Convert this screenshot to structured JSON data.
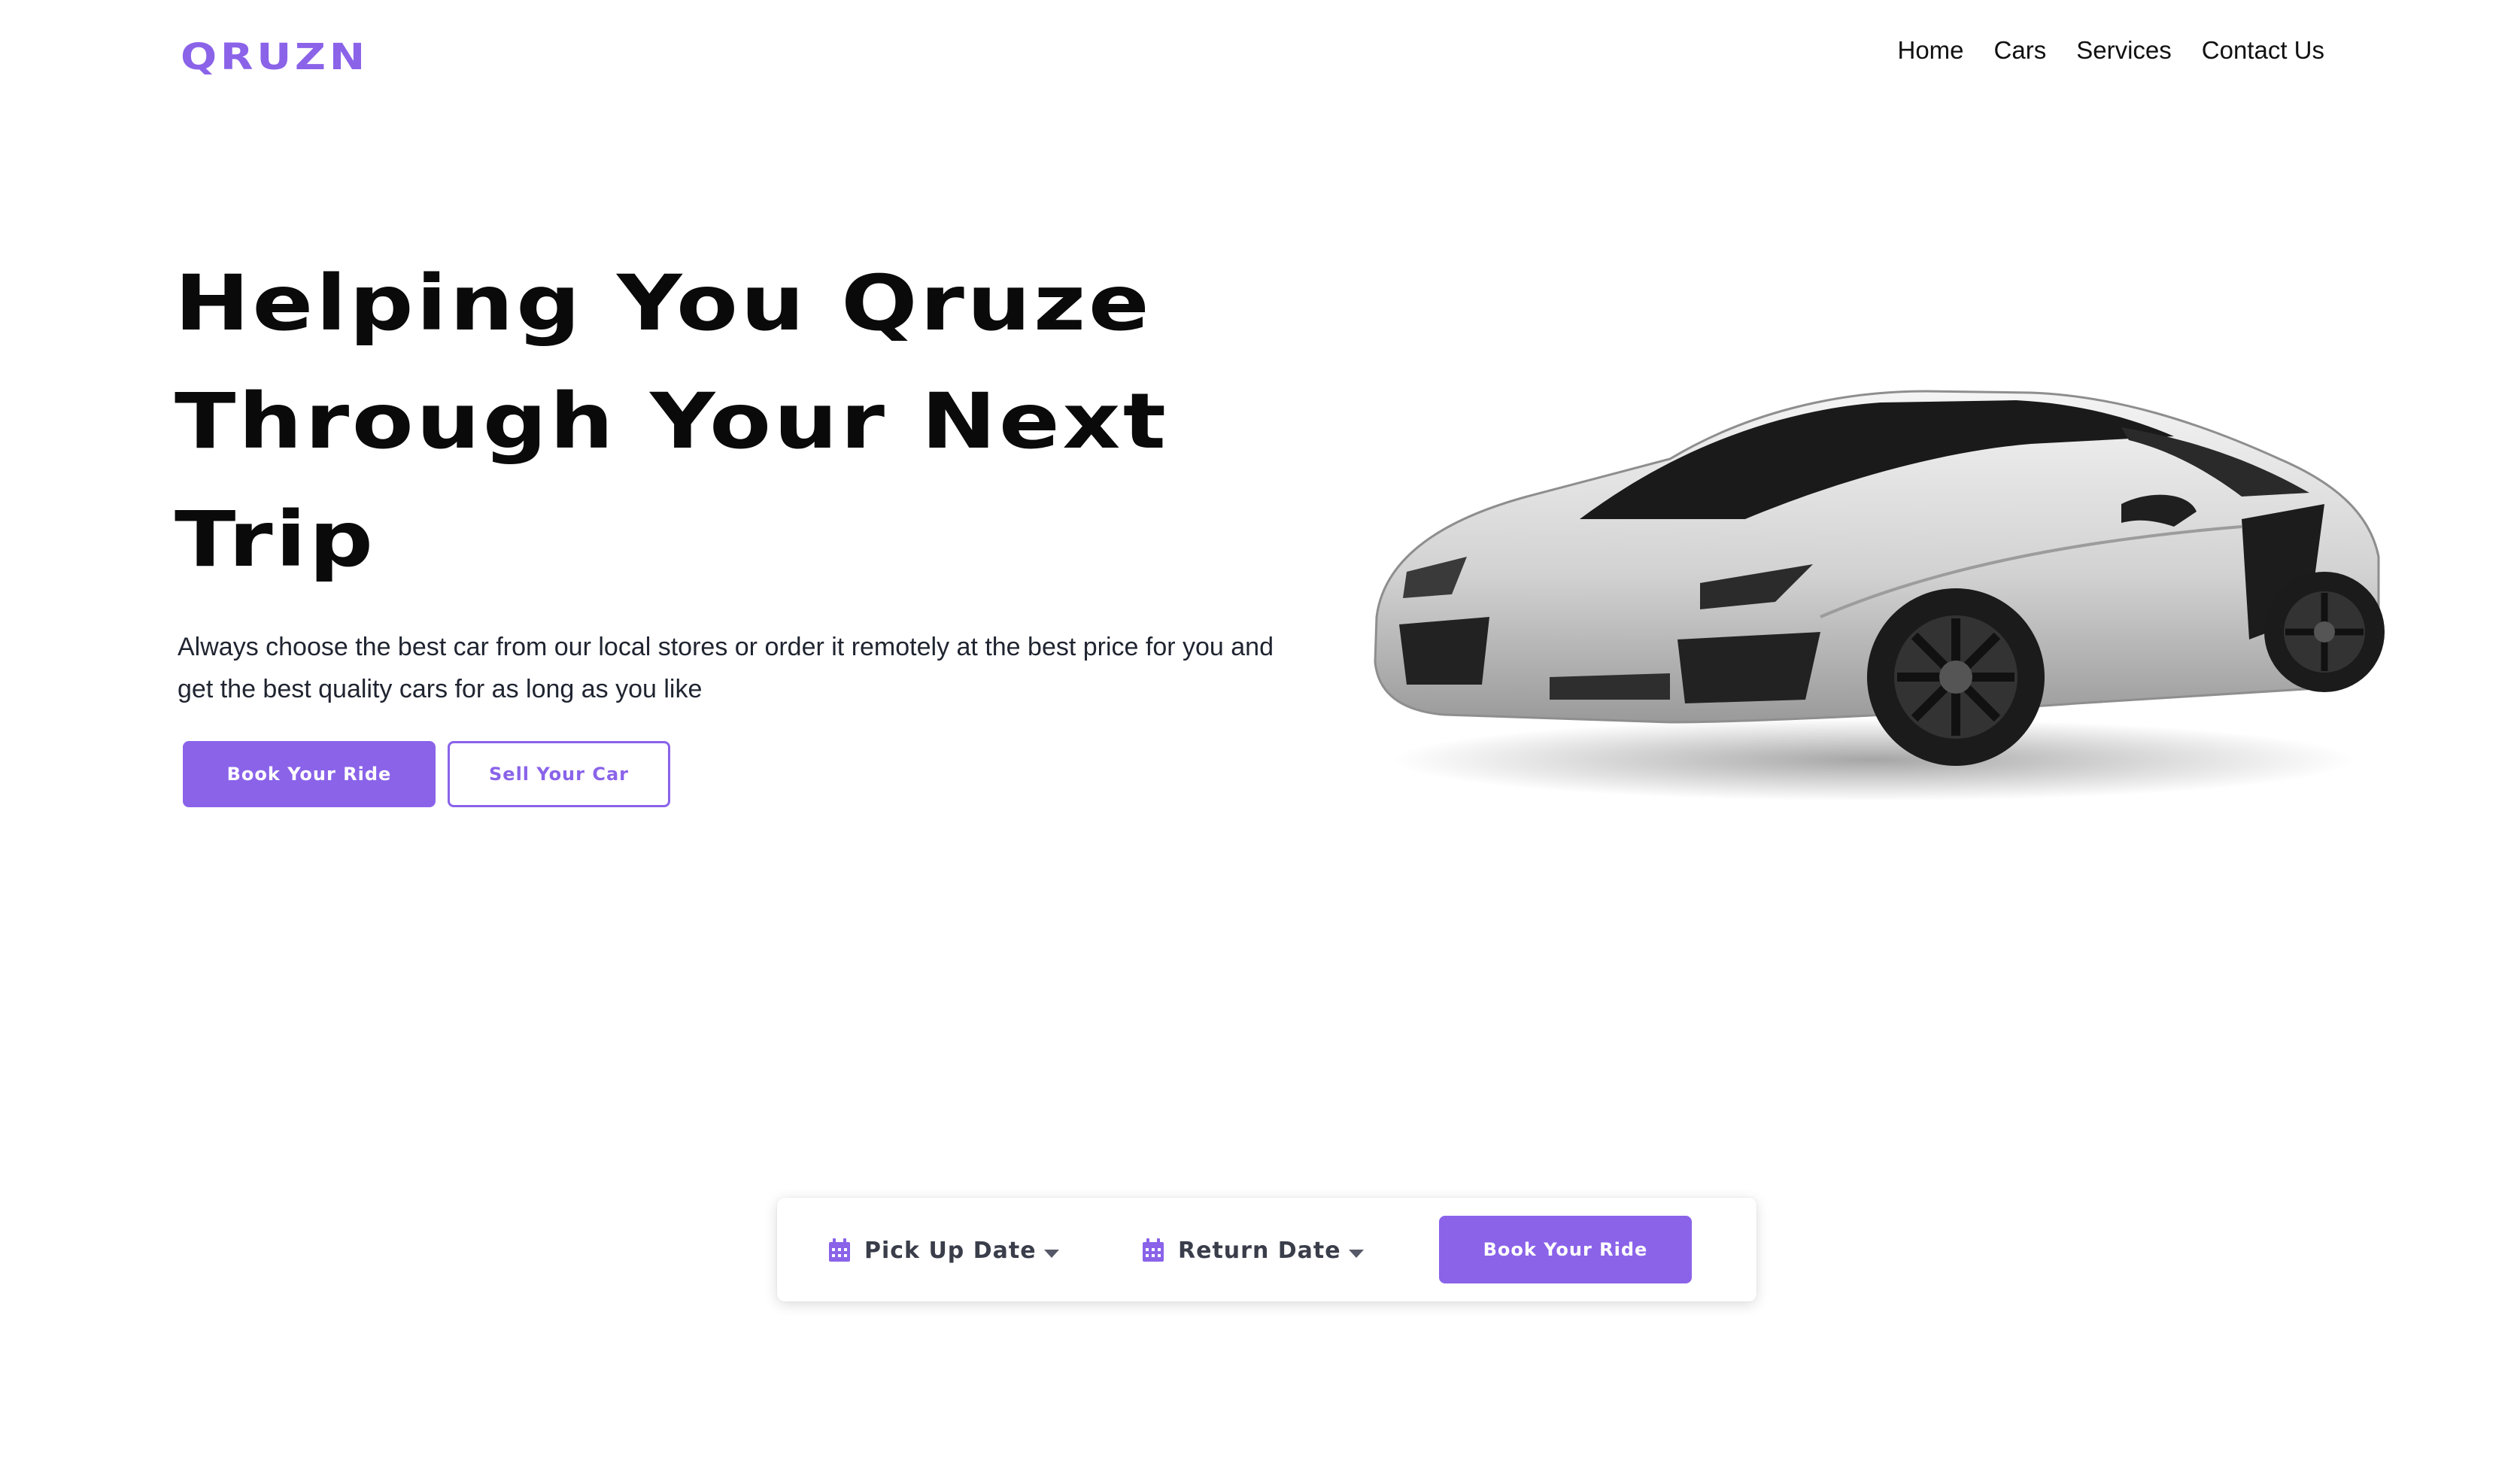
{
  "brand": {
    "logo": "QRUZN",
    "accent_color": "#8a63e9"
  },
  "nav": {
    "items": [
      {
        "label": "Home"
      },
      {
        "label": "Cars"
      },
      {
        "label": "Services"
      },
      {
        "label": "Contact Us"
      }
    ]
  },
  "hero": {
    "title_lines": [
      "Helping You Qruze",
      "Through Your Next",
      "Trip"
    ],
    "description": "Always choose the best car from our local stores or order it remotely at the best price for you and get the best quality cars for as long as you like",
    "primary_button": "Book Your Ride",
    "secondary_button": "Sell Your Car",
    "image": {
      "icon": "white-sports-car"
    }
  },
  "booking": {
    "pickup": {
      "label": "Pick Up Date",
      "icon": "calendar-icon"
    },
    "return": {
      "label": "Return Date",
      "icon": "calendar-icon"
    },
    "button": "Book Your Ride"
  }
}
